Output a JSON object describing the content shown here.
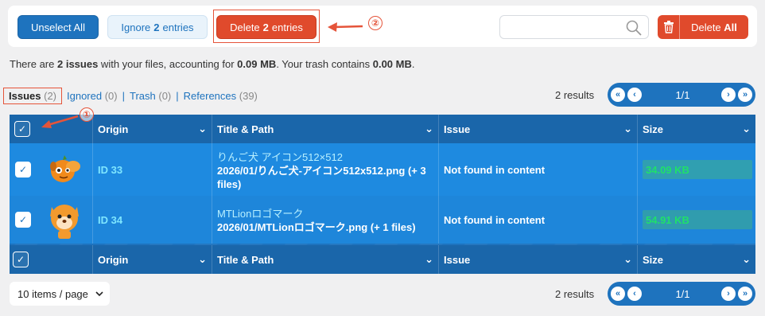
{
  "toolbar": {
    "unselect_all": "Unselect All",
    "ignore_prefix": "Ignore",
    "ignore_count": "2",
    "ignore_suffix": "entries",
    "delete_prefix": "Delete",
    "delete_count": "2",
    "delete_suffix": "entries",
    "search_placeholder": "",
    "delete_all_prefix": "Delete",
    "delete_all_bold": "All"
  },
  "annotations": {
    "one": "①",
    "two": "②",
    "color": "#e5543a"
  },
  "summary": {
    "t1": "There are ",
    "issues": "2 issues",
    "t2": " with your files, accounting for ",
    "size": "0.09 MB",
    "t3": ". Your trash contains ",
    "trash": "0.00 MB",
    "t4": "."
  },
  "tabs": [
    {
      "label": "Issues",
      "count": "(2)"
    },
    {
      "label": "Ignored",
      "count": "(0)"
    },
    {
      "label": "Trash",
      "count": "(0)"
    },
    {
      "label": "References",
      "count": "(39)"
    }
  ],
  "separator": "|",
  "pagination": {
    "results": "2 results",
    "page": "1/1",
    "first": "«",
    "prev": "‹",
    "next": "›",
    "last": "»"
  },
  "table": {
    "columns": [
      "Origin",
      "Title & Path",
      "Issue",
      "Size"
    ],
    "check": "✓",
    "chevron": "⌄",
    "rows": [
      {
        "id": "ID 33",
        "title": "りんご犬 アイコン512×512",
        "path": "2026/01/りんご犬-アイコン512x512.png (+ 3 files)",
        "issue": "Not found in content",
        "size": "34.09 KB"
      },
      {
        "id": "ID 34",
        "title": "MTLionロゴマーク",
        "path": "2026/01/MTLionロゴマーク.png (+ 1 files)",
        "issue": "Not found in content",
        "size": "54.91 KB"
      }
    ]
  },
  "per_page": "10 items / page",
  "colors": {
    "primary": "#1e73be",
    "danger": "#e04a2c",
    "row": "#1e8ae0",
    "size_text": "#1fe06a"
  }
}
